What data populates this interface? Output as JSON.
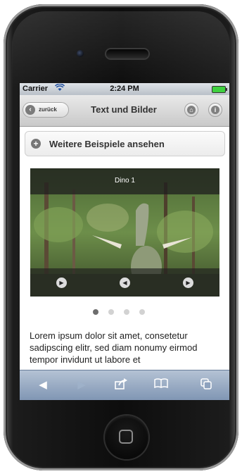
{
  "status_bar": {
    "carrier": "Carrier",
    "time": "2:24 PM"
  },
  "header": {
    "back_label": "zurück",
    "title": "Text und Bilder",
    "home_icon": "home-icon",
    "info_icon": "info-icon"
  },
  "more_button": {
    "label": "Weitere Beispiele ansehen",
    "icon": "plus-icon"
  },
  "slider": {
    "caption": "Dino 1",
    "controls": [
      "play-icon",
      "previous-icon",
      "next-icon"
    ],
    "dots": {
      "count": 4,
      "active_index": 0
    }
  },
  "content": {
    "text": "Lorem ipsum dolor sit amet, consetetur sadipscing elitr, sed diam nonumy eirmod tempor invidunt ut labore et"
  },
  "toolbar": {
    "icons": [
      "back-icon",
      "forward-icon",
      "share-icon",
      "bookmarks-icon",
      "tabs-icon"
    ]
  },
  "colors": {
    "toolbar": "#8ea2be",
    "header": "#d6d6d6",
    "accent_gray": "#777777"
  }
}
